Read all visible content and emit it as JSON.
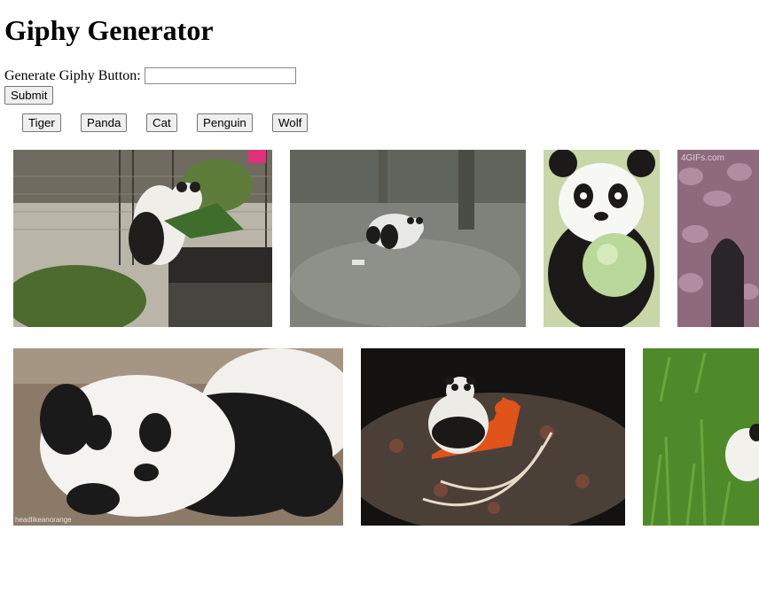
{
  "page": {
    "title": "Giphy Generator"
  },
  "form": {
    "label": "Generate Giphy Button:",
    "input_value": "",
    "submit_label": "Submit"
  },
  "topics": [
    "Tiger",
    "Panda",
    "Cat",
    "Penguin",
    "Wolf"
  ],
  "gifs": [
    {
      "subject": "panda climbing fence",
      "watermark": ""
    },
    {
      "subject": "panda walking on grass",
      "watermark": ""
    },
    {
      "subject": "panda holding ball",
      "watermark": ""
    },
    {
      "subject": "panda in tree trunk",
      "watermark": "4GIFs.com"
    },
    {
      "subject": "panda lying down",
      "watermark": "headlikeanorange"
    },
    {
      "subject": "panda on rocking horse",
      "watermark": ""
    },
    {
      "subject": "panda in grass",
      "watermark": ""
    }
  ]
}
